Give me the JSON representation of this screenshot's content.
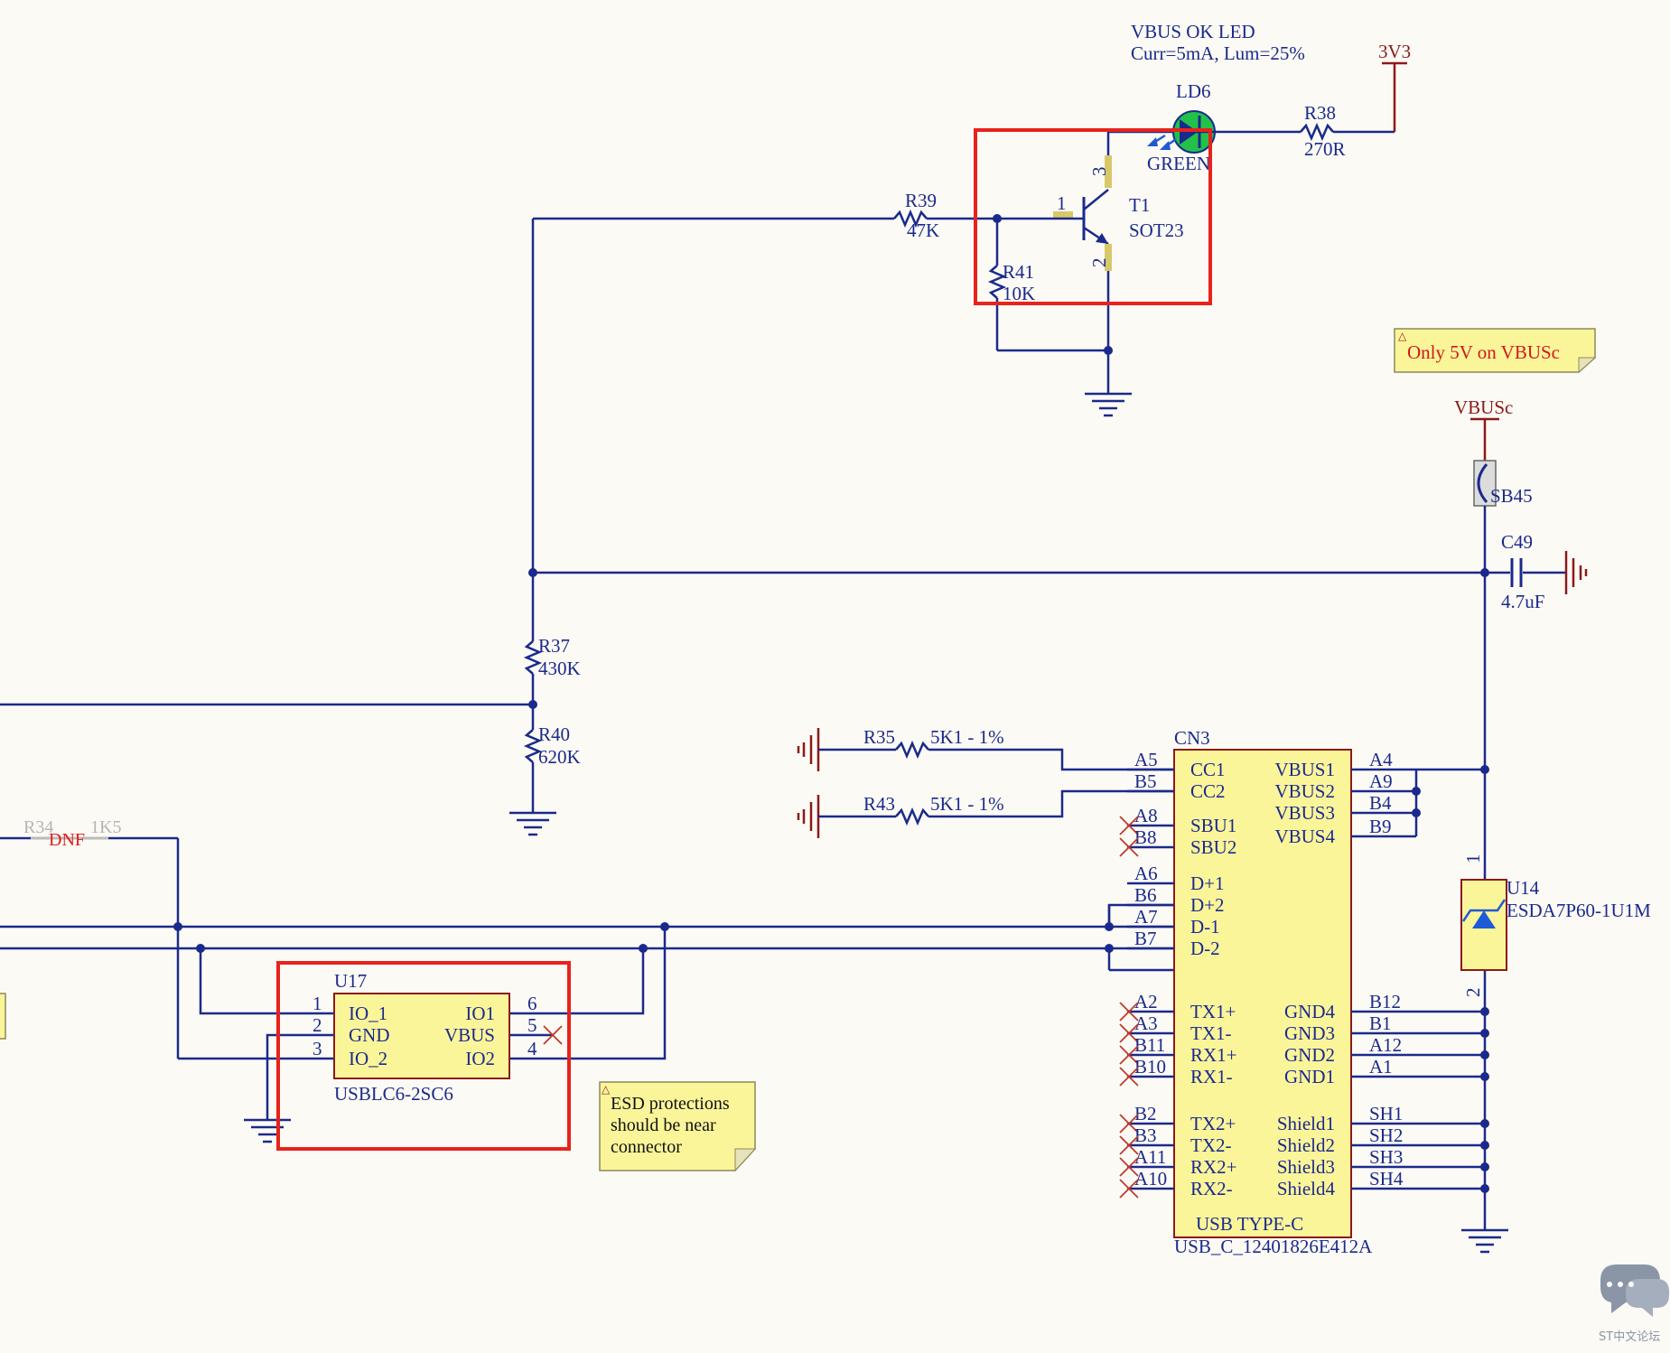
{
  "ld6": {
    "label": "LD6",
    "color": "GREEN",
    "note_line1": "VBUS OK LED",
    "note_line2": "Curr=5mA, Lum=25%"
  },
  "r38": {
    "ref": "R38",
    "value": "270R"
  },
  "power_3v3": "3V3",
  "t1": {
    "ref": "T1",
    "package": "SOT23",
    "pin1": "1",
    "pin2": "2",
    "pin3": "3"
  },
  "r39": {
    "ref": "R39",
    "value": "47K"
  },
  "r41": {
    "ref": "R41",
    "value": "10K"
  },
  "note_vbusc": "Only 5V on VBUSc",
  "power_vbusc": "VBUSc",
  "sb45": {
    "ref": "SB45"
  },
  "c49": {
    "ref": "C49",
    "value": "4.7uF"
  },
  "r37": {
    "ref": "R37",
    "value": "430K"
  },
  "r40": {
    "ref": "R40",
    "value": "620K"
  },
  "r35": {
    "ref": "R35",
    "value": "5K1 - 1%"
  },
  "r43": {
    "ref": "R43",
    "value": "5K1 - 1%"
  },
  "r34": {
    "ref": "R34",
    "value": "1K5",
    "dnf": "DNF"
  },
  "cn3": {
    "ref": "CN3",
    "type": "USB TYPE-C",
    "part": "USB_C_12401826E412A",
    "left_pins": [
      {
        "pin": "A5",
        "name": "CC1"
      },
      {
        "pin": "B5",
        "name": "CC2"
      },
      {
        "pin": "A8",
        "name": "SBU1"
      },
      {
        "pin": "B8",
        "name": "SBU2"
      },
      {
        "pin": "A6",
        "name": "D+1"
      },
      {
        "pin": "B6",
        "name": "D+2"
      },
      {
        "pin": "A7",
        "name": "D-1"
      },
      {
        "pin": "B7",
        "name": "D-2"
      },
      {
        "pin": "A2",
        "name": "TX1+"
      },
      {
        "pin": "A3",
        "name": "TX1-"
      },
      {
        "pin": "B11",
        "name": "RX1+"
      },
      {
        "pin": "B10",
        "name": "RX1-"
      },
      {
        "pin": "B2",
        "name": "TX2+"
      },
      {
        "pin": "B3",
        "name": "TX2-"
      },
      {
        "pin": "A11",
        "name": "RX2+"
      },
      {
        "pin": "A10",
        "name": "RX2-"
      }
    ],
    "right_pins": [
      {
        "pin": "A4",
        "name": "VBUS1"
      },
      {
        "pin": "A9",
        "name": "VBUS2"
      },
      {
        "pin": "B4",
        "name": "VBUS3"
      },
      {
        "pin": "B9",
        "name": "VBUS4"
      },
      {
        "pin": "B12",
        "name": "GND4"
      },
      {
        "pin": "B1",
        "name": "GND3"
      },
      {
        "pin": "A12",
        "name": "GND2"
      },
      {
        "pin": "A1",
        "name": "GND1"
      },
      {
        "pin": "SH1",
        "name": "Shield1"
      },
      {
        "pin": "SH2",
        "name": "Shield2"
      },
      {
        "pin": "SH3",
        "name": "Shield3"
      },
      {
        "pin": "SH4",
        "name": "Shield4"
      }
    ]
  },
  "u14": {
    "ref": "U14",
    "part": "ESDA7P60-1U1M",
    "pin1": "1",
    "pin2": "2"
  },
  "u17": {
    "ref": "U17",
    "part": "USBLC6-2SC6",
    "left_pins": [
      {
        "pin": "1",
        "name": "IO_1"
      },
      {
        "pin": "2",
        "name": "GND"
      },
      {
        "pin": "3",
        "name": "IO_2"
      }
    ],
    "right_pins": [
      {
        "pin": "6",
        "name": "IO1"
      },
      {
        "pin": "5",
        "name": "VBUS"
      },
      {
        "pin": "4",
        "name": "IO2"
      }
    ]
  },
  "note_esd": {
    "line1": "ESD protections",
    "line2": "should be near",
    "line3": "connector"
  },
  "watermark": "ST中文论坛",
  "colors": {
    "wire": "#1a2a8c",
    "power": "#8b1a1a",
    "component_fill": "#fbf59a",
    "highlight": "#e8221c",
    "led": "#22c24a"
  }
}
